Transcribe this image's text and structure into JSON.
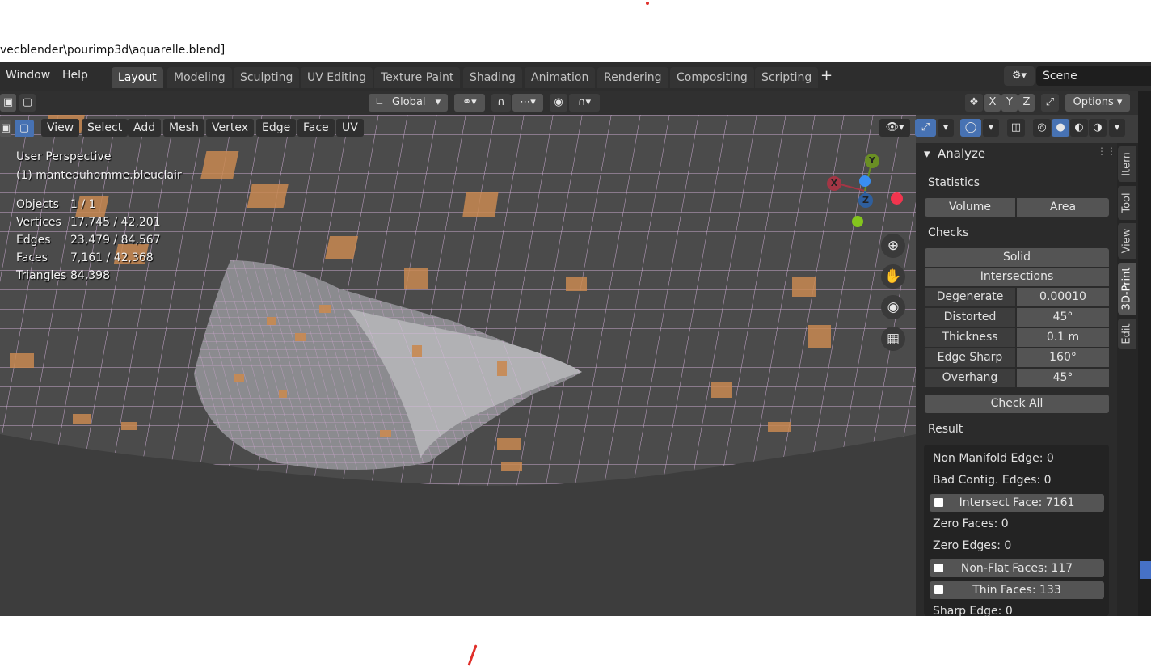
{
  "window": {
    "title_path": "vecblender\\pourimp3d\\aquarelle.blend]"
  },
  "menubar": {
    "menus": [
      "Window",
      "Help"
    ],
    "workspaces": [
      "Layout",
      "Modeling",
      "Sculpting",
      "UV Editing",
      "Texture Paint",
      "Shading",
      "Animation",
      "Rendering",
      "Compositing",
      "Scripting"
    ],
    "active_workspace": "Layout",
    "add_workspace_icon": "+",
    "scene_label": "Scene"
  },
  "toolbar": {
    "transform_orientation": "Global",
    "axis_x": "X",
    "axis_y": "Y",
    "axis_z": "Z",
    "options_label": "Options"
  },
  "viewport_header": {
    "menus": [
      "View",
      "Select",
      "Add",
      "Mesh",
      "Vertex",
      "Edge",
      "Face",
      "UV"
    ]
  },
  "overlay": {
    "perspective": "User Perspective",
    "object_name": "(1) manteauhomme.bleuclair",
    "stats": [
      {
        "label": "Objects",
        "value": "1 / 1"
      },
      {
        "label": "Vertices",
        "value": "17,745 / 42,201"
      },
      {
        "label": "Edges",
        "value": "23,479 / 84,567"
      },
      {
        "label": "Faces",
        "value": "7,161 / 42,368"
      },
      {
        "label": "Triangles",
        "value": "84,398"
      }
    ]
  },
  "gizmo": {
    "x": "X",
    "y": "Y",
    "z": "Z"
  },
  "npanel": {
    "panel_title": "Analyze",
    "statistics_header": "Statistics",
    "volume_label": "Volume",
    "area_label": "Area",
    "checks_header": "Checks",
    "solid_label": "Solid",
    "intersections_label": "Intersections",
    "checks": [
      {
        "label": "Degenerate",
        "value": "0.00010"
      },
      {
        "label": "Distorted",
        "value": "45°"
      },
      {
        "label": "Thickness",
        "value": "0.1 m"
      },
      {
        "label": "Edge Sharp",
        "value": "160°"
      },
      {
        "label": "Overhang",
        "value": "45°"
      }
    ],
    "check_all_label": "Check All",
    "result_header": "Result",
    "results": {
      "non_manifold": "Non Manifold Edge: 0",
      "bad_contig": "Bad Contig. Edges: 0",
      "intersect_face": "Intersect Face: 7161",
      "zero_faces": "Zero Faces: 0",
      "zero_edges": "Zero Edges: 0",
      "non_flat": "Non-Flat Faces: 117",
      "thin_faces": "Thin Faces: 133",
      "sharp_edge": "Sharp Edge: 0"
    }
  },
  "sidebar_tabs": [
    "Item",
    "Tool",
    "View",
    "3D-Print",
    "Edit"
  ],
  "active_sidebar_tab": "3D-Print",
  "colors": {
    "selected_face": "#c98a52",
    "wire": "#c9a9cf",
    "active_tab": "#474747"
  }
}
